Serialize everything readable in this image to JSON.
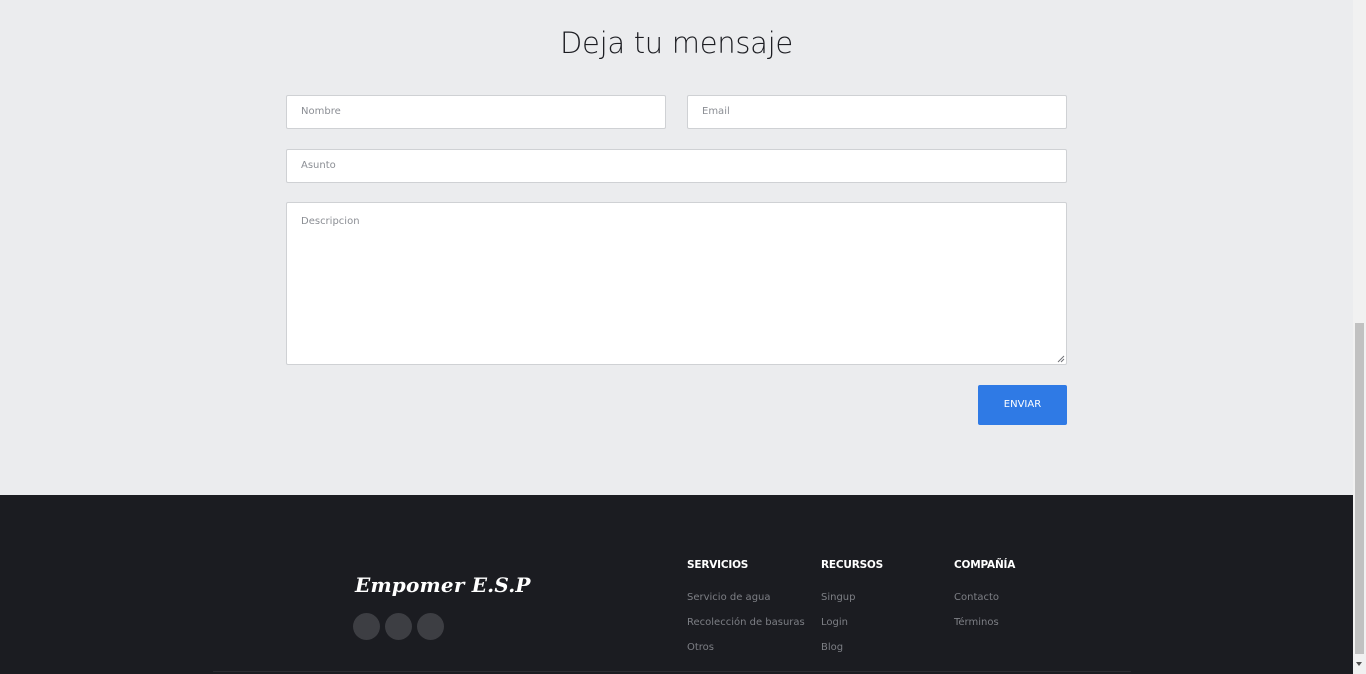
{
  "contact": {
    "title": "Deja tu mensaje",
    "fields": {
      "name_placeholder": "Nombre",
      "email_placeholder": "Email",
      "subject_placeholder": "Asunto",
      "description_placeholder": "Descripcion"
    },
    "send_label": "ENVIAR",
    "send_color": "#2f7ae5"
  },
  "footer": {
    "brand": "Empomer E.S.P",
    "social_icons": [
      "social-icon",
      "social-icon",
      "social-icon"
    ],
    "columns": [
      {
        "title": "SERVICIOS",
        "links": [
          "Servicio de agua",
          "Recolección de basuras",
          "Otros"
        ]
      },
      {
        "title": "RECURSOS",
        "links": [
          "Singup",
          "Login",
          "Blog"
        ]
      },
      {
        "title": "COMPAÑÍA",
        "links": [
          "Contacto",
          "Términos"
        ]
      }
    ],
    "background_color": "#1b1c21"
  }
}
